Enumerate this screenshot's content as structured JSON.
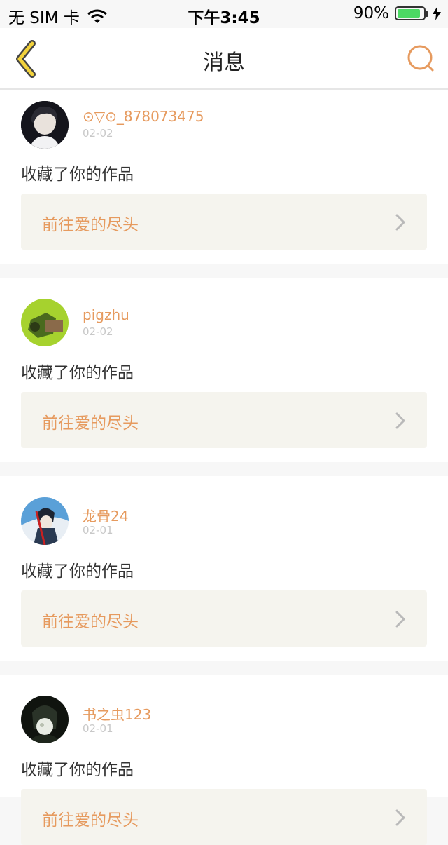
{
  "status": {
    "carrier": "无 SIM 卡",
    "time": "下午3:45",
    "battery": "90%",
    "battery_level": 0.9
  },
  "nav": {
    "title": "消息"
  },
  "colors": {
    "accent": "#e69a5e",
    "back_yellow": "#f2d23c",
    "link_bg": "#f5f4ee",
    "battery_green": "#4cd964"
  },
  "messages": [
    {
      "user": "⊙▽⊙_878073475",
      "date": "02-02",
      "action": "收藏了你的作品",
      "link": "前往爱的尽头"
    },
    {
      "user": "pigzhu",
      "date": "02-02",
      "action": "收藏了你的作品",
      "link": "前往爱的尽头"
    },
    {
      "user": "龙骨24",
      "date": "02-01",
      "action": "收藏了你的作品",
      "link": "前往爱的尽头"
    },
    {
      "user": "书之虫123",
      "date": "02-01",
      "action": "收藏了你的作品",
      "link": "前往爱的尽头"
    }
  ]
}
